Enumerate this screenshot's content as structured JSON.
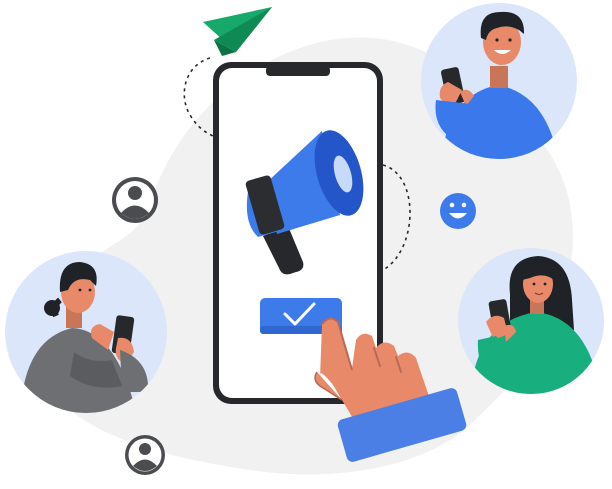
{
  "illustration": {
    "palette": {
      "blob": "#f1f1f1",
      "phone_frame": "#26282c",
      "phone_screen": "#ffffff",
      "accent_blue": "#3d7bea",
      "accent_blue_dark": "#2456c9",
      "paper_plane": "#17a96b",
      "avatar_bg": "#dbe6fb",
      "skin": "#e88a6a",
      "skin_dark": "#b86a56",
      "hair": "#1f2226",
      "shirt_blue": "#3a78ec",
      "shirt_gray": "#6e6f72",
      "shirt_green": "#18ae7e",
      "cuff_blue": "#4b7fe6",
      "user_icon": "#4a4c50",
      "emoji_bg": "#3d7bea"
    },
    "icons": [
      "paper-plane-icon",
      "megaphone-icon",
      "checkmark-icon",
      "user-icon",
      "smiley-icon",
      "pointing-hand-icon"
    ],
    "people": [
      "man-blue-shirt",
      "woman-gray-sweater",
      "woman-green-shirt"
    ]
  }
}
